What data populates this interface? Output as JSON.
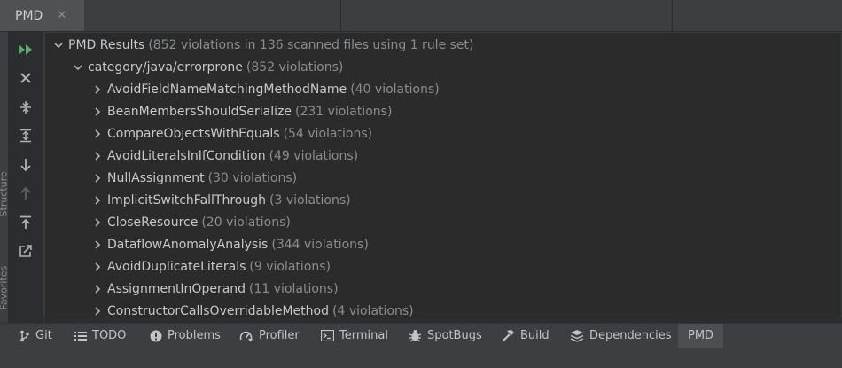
{
  "tab": {
    "title": "PMD",
    "close": "✕"
  },
  "left_strip": {
    "labels": [
      "Structure",
      "Favorites"
    ]
  },
  "toolbar": {
    "buttons": [
      {
        "name": "rerun-icon"
      },
      {
        "name": "close-icon"
      },
      {
        "name": "collapse-all-icon"
      },
      {
        "name": "expand-all-icon"
      },
      {
        "name": "next-icon"
      },
      {
        "name": "previous-icon"
      },
      {
        "name": "export-icon"
      },
      {
        "name": "jump-to-source-icon"
      }
    ]
  },
  "tree": {
    "root": {
      "label": "PMD Results",
      "count": "(852 violations in 136 scanned files using 1 rule set)"
    },
    "category": {
      "label": "category/java/errorprone",
      "count": "(852 violations)"
    },
    "rules": [
      {
        "label": "AvoidFieldNameMatchingMethodName",
        "count": "(40 violations)"
      },
      {
        "label": "BeanMembersShouldSerialize",
        "count": "(231 violations)"
      },
      {
        "label": "CompareObjectsWithEquals",
        "count": "(54 violations)"
      },
      {
        "label": "AvoidLiteralsInIfCondition",
        "count": "(49 violations)"
      },
      {
        "label": "NullAssignment",
        "count": "(30 violations)"
      },
      {
        "label": "ImplicitSwitchFallThrough",
        "count": "(3 violations)"
      },
      {
        "label": "CloseResource",
        "count": "(20 violations)"
      },
      {
        "label": "DataflowAnomalyAnalysis",
        "count": "(344 violations)"
      },
      {
        "label": "AvoidDuplicateLiterals",
        "count": "(9 violations)"
      },
      {
        "label": "AssignmentInOperand",
        "count": "(11 violations)"
      },
      {
        "label": "ConstructorCallsOverridableMethod",
        "count": "(4 violations)"
      }
    ]
  },
  "bottom_tabs": [
    {
      "label": "Git",
      "icon": "git-branch-icon"
    },
    {
      "label": "TODO",
      "icon": "todo-list-icon"
    },
    {
      "label": "Problems",
      "icon": "problems-icon"
    },
    {
      "label": "Profiler",
      "icon": "profiler-icon"
    },
    {
      "label": "Terminal",
      "icon": "terminal-icon"
    },
    {
      "label": "SpotBugs",
      "icon": "spotbugs-icon"
    },
    {
      "label": "Build",
      "icon": "build-hammer-icon"
    },
    {
      "label": "Dependencies",
      "icon": "dependencies-icon"
    },
    {
      "label": "PMD",
      "icon": "",
      "active": true
    }
  ],
  "colors": {
    "accent_green": "#59a869",
    "text": "#c6c8ca",
    "muted": "#8b8d8f"
  }
}
